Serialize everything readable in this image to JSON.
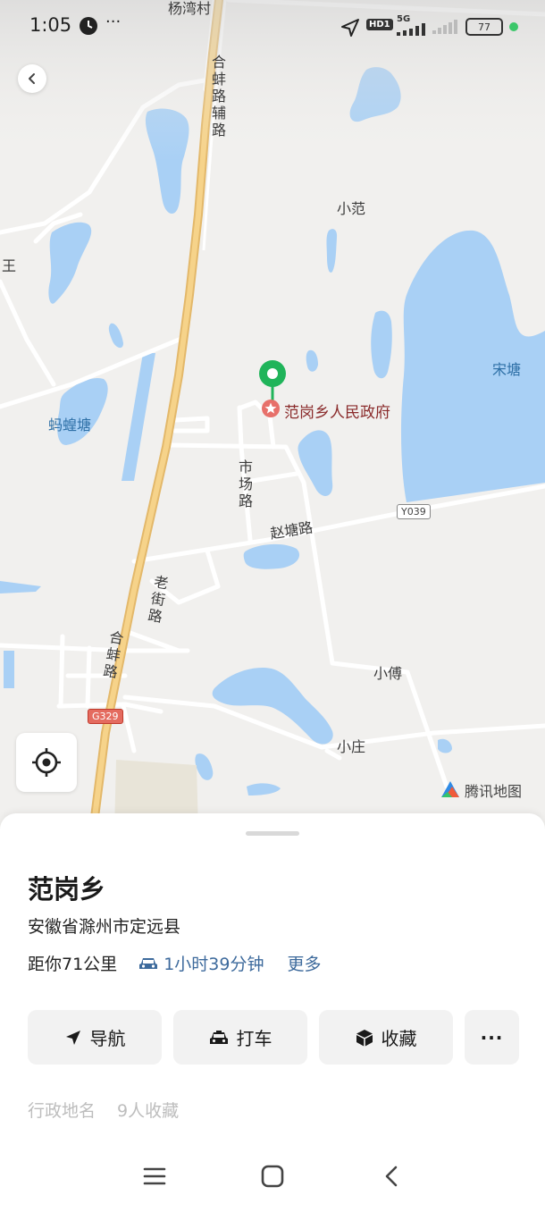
{
  "status_bar": {
    "time": "1:05",
    "dots": "···",
    "indicators": [
      "clock-icon",
      "location-arrow-icon",
      "hd-icon",
      "signal-5g-icon",
      "signal-icon",
      "battery-icon"
    ],
    "hd_label": "HD1",
    "net_label": "5G",
    "battery": "77",
    "battery_dot_color": "#3cc76a"
  },
  "map": {
    "labels": {
      "village_top": "杨湾村",
      "road_main_north": "合蚌路辅路",
      "xiaofan": "小范",
      "wang": "王",
      "songtang": "宋塘",
      "mahuangtang": "蚂蝗塘",
      "shichang_road": "市场路",
      "zhaotang_road": "赵塘路",
      "laojie_road": "老街路",
      "hebeng_road": "合蚌路",
      "xiaofu": "小傅",
      "xiaozhuang": "小庄"
    },
    "shields": {
      "y039": "Y039",
      "g329": "G329"
    },
    "poi": {
      "name": "范岗乡人民政府",
      "pin_color": "#20b45a",
      "marker_color": "#e7706a"
    },
    "watermark": "腾讯地图",
    "colors": {
      "land": "#f1f0ee",
      "water": "#a9d0f5",
      "highway": "#f6d38a"
    }
  },
  "sheet": {
    "title": "范岗乡",
    "address": "安徽省滁州市定远县",
    "distance": "距你71公里",
    "drive_time": "1小时39分钟",
    "more": "更多",
    "actions": [
      {
        "label": "导航",
        "icon": "navigation-arrow-icon"
      },
      {
        "label": "打车",
        "icon": "taxi-icon"
      },
      {
        "label": "收藏",
        "icon": "box-icon"
      }
    ],
    "more_actions_label": "···",
    "tags": [
      "行政地名",
      "9人收藏"
    ]
  },
  "nav_bar": {
    "buttons": [
      "menu-icon",
      "home-icon",
      "back-icon"
    ]
  },
  "colors": {
    "link": "#3d6a9c",
    "button_bg": "#f2f2f2"
  }
}
